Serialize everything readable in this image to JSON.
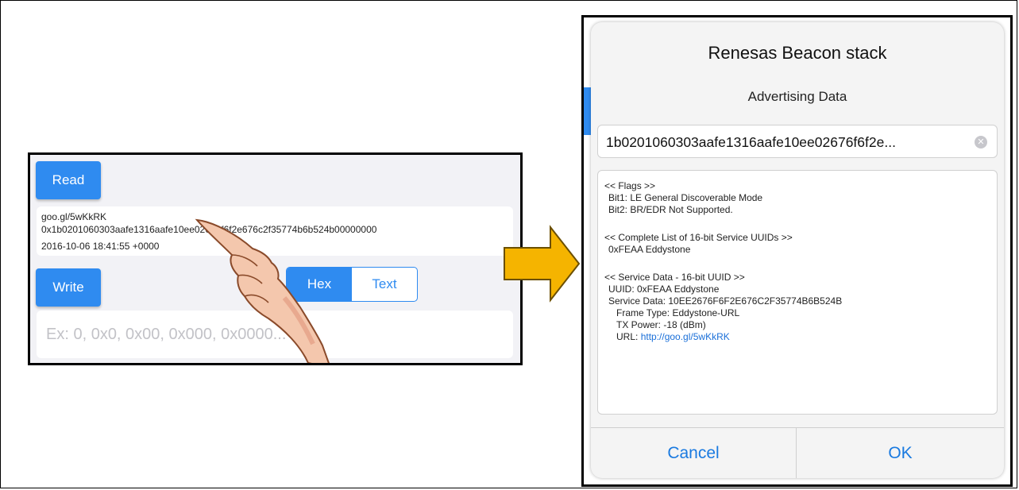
{
  "left": {
    "read_label": "Read",
    "read_lines": [
      "goo.gl/5wKkRK",
      "0x1b0201060303aafe1316aafe10ee02676f6f2e676c2f35774b6b524b00000000",
      "2016-10-06 18:41:55 +0000"
    ],
    "write_label": "Write",
    "seg_hex": "Hex",
    "seg_text": "Text",
    "input_placeholder": "Ex: 0, 0x0, 0x00, 0x000, 0x0000..."
  },
  "dialog": {
    "title": "Renesas Beacon stack",
    "subtitle": "Advertising Data",
    "adv_value": "1b0201060303aafe1316aafe10ee02676f6f2e...",
    "lines": [
      "<< Flags >>",
      "  Bit1: LE General Discoverable Mode",
      "  Bit2: BR/EDR Not Supported.",
      "",
      "<< Complete List of 16-bit Service UUIDs >>",
      "  0xFEAA  Eddystone",
      "",
      "<< Service Data - 16-bit UUID >>",
      "  UUID: 0xFEAA Eddystone",
      "  Service Data: 10EE2676F6F2E676C2F35774B6B524B",
      "    Frame Type: Eddystone-URL",
      "    TX Power: -18 (dBm)"
    ],
    "url_label": "    URL: ",
    "url_link": "http://goo.gl/5wKkRK",
    "cancel_label": "Cancel",
    "ok_label": "OK"
  },
  "icons": {
    "arrow": "arrow-right-icon",
    "hand": "pointing-hand-icon",
    "clear": "clear-circle-icon"
  },
  "colors": {
    "accent": "#2f8bf0",
    "link": "#1a6fd8",
    "arrow": "#f5b400"
  }
}
